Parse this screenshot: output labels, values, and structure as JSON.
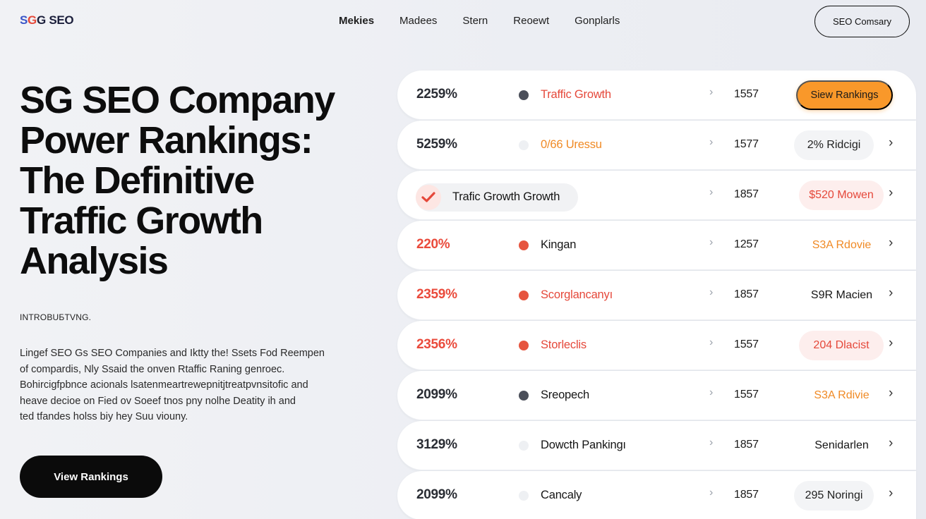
{
  "header": {
    "logo_a": "S",
    "logo_b": "G",
    "logo_rest": "G SEO",
    "nav": [
      "Mekies",
      "Madees",
      "Stern",
      "Reoewt",
      "Gonplarls"
    ],
    "cta_label": "SEO Comsary"
  },
  "hero": {
    "title_lines": [
      "SG SEO Company",
      "Power Rankings:",
      "The Definitive",
      "Traffic Growth",
      "Analysis"
    ],
    "intro_label": "INTROBUБTVNG.",
    "intro_lines": [
      "Lingef SEO Gs SEO Companies and Iktty the! Ssets Fod Reempen",
      "of compardis, Nly Ssaid the onven Rtaffic Raning genroec.",
      "Bohircigfpbnce acionals lsatenmeartrewepnitjtreatpvnsitofic and",
      "heave decioe on Fied ov Soeef tnos pny nolhe Deatity ih and",
      "ted tfandes holss biy hey Suu viouny."
    ],
    "button_label": "View Rankings"
  },
  "rankings": {
    "rows": [
      {
        "pct": "2259%",
        "name": "Traffic Growth",
        "num": "1557",
        "action": "Siew Rankings"
      },
      {
        "pct": "5259%",
        "name": "0/66 Uressu",
        "num": "1577",
        "action": "2% Ridcigi"
      },
      {
        "pct": "",
        "name": "Trafic Growth Growth",
        "num": "1857",
        "action": "$520 Mowen"
      },
      {
        "pct": "220%",
        "name": "Kingan",
        "num": "1257",
        "action": "S3A Rdovie"
      },
      {
        "pct": "2359%",
        "name": "Scorglancanyı",
        "num": "1857",
        "action": "S9R Macien"
      },
      {
        "pct": "2356%",
        "name": "Storleclis",
        "num": "1557",
        "action": "204 Dlacist"
      },
      {
        "pct": "2099%",
        "name": "Sreopech",
        "num": "1557",
        "action": "S3A Rdivie"
      },
      {
        "pct": "3129%",
        "name": "Dowcth Pankingı",
        "num": "1857",
        "action": "Senidarlen"
      },
      {
        "pct": "2099%",
        "name": "Cancaly",
        "num": "1857",
        "action": "295 Noringi"
      }
    ]
  },
  "icons": {
    "row_chevron": "chevron-right-icon",
    "bullet": "dot-icon",
    "check": "check-icon"
  },
  "colors": {
    "accent_orange": "#f9982a",
    "accent_red": "#e5483a",
    "dark": "#0b0b0b"
  }
}
